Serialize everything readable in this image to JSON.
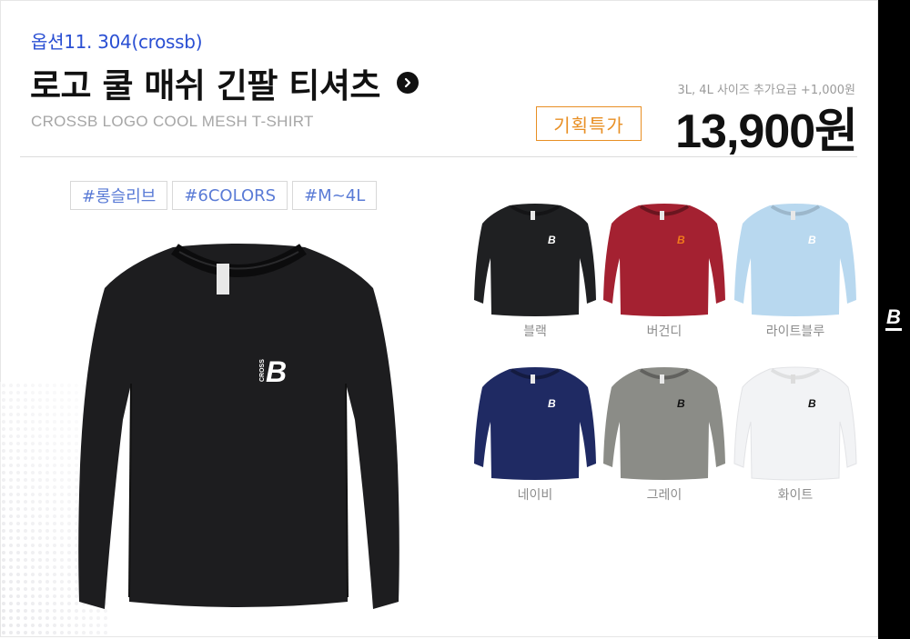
{
  "product": {
    "option_label": "옵션11. 304(crossb)",
    "title": "로고 쿨 매쉬 긴팔 티셔츠",
    "subtitle": "CROSSB LOGO COOL MESH T-SHIRT",
    "surcharge_note": "3L, 4L 사이즈 추가요금 +1,000원",
    "special_badge": "기획특가",
    "price": "13,900원"
  },
  "tags": [
    "#롱슬리브",
    "#6COLORS",
    "#M~4L"
  ],
  "main_image": {
    "color": "#1d1d1f",
    "logo_text": "CROSS",
    "logo_letter": "B"
  },
  "swatches": [
    {
      "label": "블랙",
      "color": "#1f2022",
      "logo_color": "#ffffff"
    },
    {
      "label": "버건디",
      "color": "#a42131",
      "logo_color": "#f07a1c"
    },
    {
      "label": "라이트블루",
      "color": "#b8d8ef",
      "logo_color": "#ffffff"
    },
    {
      "label": "네이비",
      "color": "#1f2a63",
      "logo_color": "#ffffff"
    },
    {
      "label": "그레이",
      "color": "#8b8c87",
      "logo_color": "#111111"
    },
    {
      "label": "화이트",
      "color": "#f2f3f5",
      "logo_color": "#111111"
    }
  ],
  "side_logo_letter": "B",
  "icons": {
    "title_arrow": "chevron-right-icon",
    "side_logo": "crossb-logo-icon"
  }
}
